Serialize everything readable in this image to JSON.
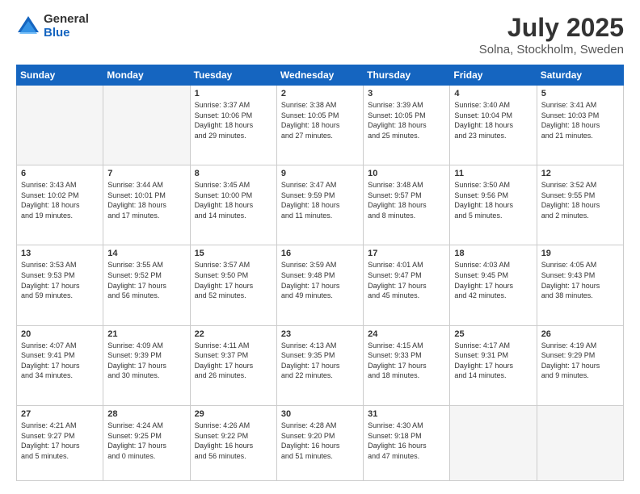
{
  "header": {
    "logo_general": "General",
    "logo_blue": "Blue",
    "title": "July 2025",
    "location": "Solna, Stockholm, Sweden"
  },
  "weekdays": [
    "Sunday",
    "Monday",
    "Tuesday",
    "Wednesday",
    "Thursday",
    "Friday",
    "Saturday"
  ],
  "weeks": [
    [
      {
        "day": "",
        "info": ""
      },
      {
        "day": "",
        "info": ""
      },
      {
        "day": "1",
        "info": "Sunrise: 3:37 AM\nSunset: 10:06 PM\nDaylight: 18 hours\nand 29 minutes."
      },
      {
        "day": "2",
        "info": "Sunrise: 3:38 AM\nSunset: 10:05 PM\nDaylight: 18 hours\nand 27 minutes."
      },
      {
        "day": "3",
        "info": "Sunrise: 3:39 AM\nSunset: 10:05 PM\nDaylight: 18 hours\nand 25 minutes."
      },
      {
        "day": "4",
        "info": "Sunrise: 3:40 AM\nSunset: 10:04 PM\nDaylight: 18 hours\nand 23 minutes."
      },
      {
        "day": "5",
        "info": "Sunrise: 3:41 AM\nSunset: 10:03 PM\nDaylight: 18 hours\nand 21 minutes."
      }
    ],
    [
      {
        "day": "6",
        "info": "Sunrise: 3:43 AM\nSunset: 10:02 PM\nDaylight: 18 hours\nand 19 minutes."
      },
      {
        "day": "7",
        "info": "Sunrise: 3:44 AM\nSunset: 10:01 PM\nDaylight: 18 hours\nand 17 minutes."
      },
      {
        "day": "8",
        "info": "Sunrise: 3:45 AM\nSunset: 10:00 PM\nDaylight: 18 hours\nand 14 minutes."
      },
      {
        "day": "9",
        "info": "Sunrise: 3:47 AM\nSunset: 9:59 PM\nDaylight: 18 hours\nand 11 minutes."
      },
      {
        "day": "10",
        "info": "Sunrise: 3:48 AM\nSunset: 9:57 PM\nDaylight: 18 hours\nand 8 minutes."
      },
      {
        "day": "11",
        "info": "Sunrise: 3:50 AM\nSunset: 9:56 PM\nDaylight: 18 hours\nand 5 minutes."
      },
      {
        "day": "12",
        "info": "Sunrise: 3:52 AM\nSunset: 9:55 PM\nDaylight: 18 hours\nand 2 minutes."
      }
    ],
    [
      {
        "day": "13",
        "info": "Sunrise: 3:53 AM\nSunset: 9:53 PM\nDaylight: 17 hours\nand 59 minutes."
      },
      {
        "day": "14",
        "info": "Sunrise: 3:55 AM\nSunset: 9:52 PM\nDaylight: 17 hours\nand 56 minutes."
      },
      {
        "day": "15",
        "info": "Sunrise: 3:57 AM\nSunset: 9:50 PM\nDaylight: 17 hours\nand 52 minutes."
      },
      {
        "day": "16",
        "info": "Sunrise: 3:59 AM\nSunset: 9:48 PM\nDaylight: 17 hours\nand 49 minutes."
      },
      {
        "day": "17",
        "info": "Sunrise: 4:01 AM\nSunset: 9:47 PM\nDaylight: 17 hours\nand 45 minutes."
      },
      {
        "day": "18",
        "info": "Sunrise: 4:03 AM\nSunset: 9:45 PM\nDaylight: 17 hours\nand 42 minutes."
      },
      {
        "day": "19",
        "info": "Sunrise: 4:05 AM\nSunset: 9:43 PM\nDaylight: 17 hours\nand 38 minutes."
      }
    ],
    [
      {
        "day": "20",
        "info": "Sunrise: 4:07 AM\nSunset: 9:41 PM\nDaylight: 17 hours\nand 34 minutes."
      },
      {
        "day": "21",
        "info": "Sunrise: 4:09 AM\nSunset: 9:39 PM\nDaylight: 17 hours\nand 30 minutes."
      },
      {
        "day": "22",
        "info": "Sunrise: 4:11 AM\nSunset: 9:37 PM\nDaylight: 17 hours\nand 26 minutes."
      },
      {
        "day": "23",
        "info": "Sunrise: 4:13 AM\nSunset: 9:35 PM\nDaylight: 17 hours\nand 22 minutes."
      },
      {
        "day": "24",
        "info": "Sunrise: 4:15 AM\nSunset: 9:33 PM\nDaylight: 17 hours\nand 18 minutes."
      },
      {
        "day": "25",
        "info": "Sunrise: 4:17 AM\nSunset: 9:31 PM\nDaylight: 17 hours\nand 14 minutes."
      },
      {
        "day": "26",
        "info": "Sunrise: 4:19 AM\nSunset: 9:29 PM\nDaylight: 17 hours\nand 9 minutes."
      }
    ],
    [
      {
        "day": "27",
        "info": "Sunrise: 4:21 AM\nSunset: 9:27 PM\nDaylight: 17 hours\nand 5 minutes."
      },
      {
        "day": "28",
        "info": "Sunrise: 4:24 AM\nSunset: 9:25 PM\nDaylight: 17 hours\nand 0 minutes."
      },
      {
        "day": "29",
        "info": "Sunrise: 4:26 AM\nSunset: 9:22 PM\nDaylight: 16 hours\nand 56 minutes."
      },
      {
        "day": "30",
        "info": "Sunrise: 4:28 AM\nSunset: 9:20 PM\nDaylight: 16 hours\nand 51 minutes."
      },
      {
        "day": "31",
        "info": "Sunrise: 4:30 AM\nSunset: 9:18 PM\nDaylight: 16 hours\nand 47 minutes."
      },
      {
        "day": "",
        "info": ""
      },
      {
        "day": "",
        "info": ""
      }
    ]
  ]
}
